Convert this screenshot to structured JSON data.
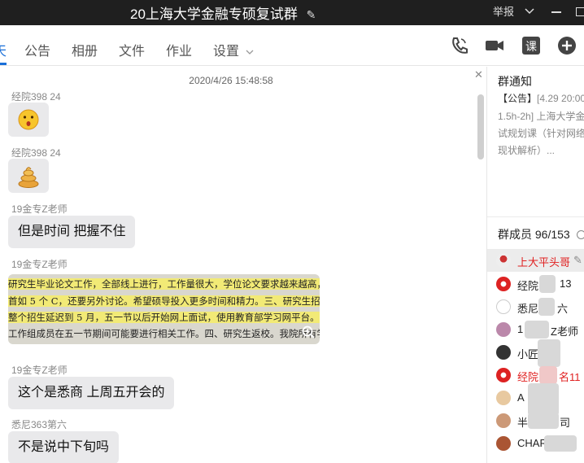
{
  "window": {
    "title": "20上海大学金融专硕复试群",
    "report": "举报"
  },
  "tabs": [
    "天",
    "公告",
    "相册",
    "文件",
    "作业",
    "设置"
  ],
  "chat": {
    "timestamp": "2020/4/26 15:48:58",
    "messages": [
      {
        "sender": "经院398  24",
        "type": "emoji",
        "emoji": "surprised-face"
      },
      {
        "sender": "经院398  24",
        "type": "emoji",
        "emoji": "poop"
      },
      {
        "sender": "19金专Z老师",
        "type": "text",
        "text": "但是时间 把握不住"
      },
      {
        "sender": "19金专Z老师",
        "type": "image"
      },
      {
        "sender": "19金专Z老师",
        "type": "text",
        "text": "这个是悉商 上周五开会的"
      },
      {
        "sender": "悉尼363第六",
        "type": "text",
        "text": "不是说中下旬吗"
      }
    ],
    "image_lines": [
      "研究生毕业论文工作，全部线上进行，工作量很大，学位论文要求越来越高，校",
      "首如 5 个 C，还要另外讨论。希望硕导投入更多时间和精力。三、研究生招生。",
      "整个招生延迟到 5 月，五一节以后开始网上面试，使用教育部学习网平台。面试",
      "工作组成员在五一节期间可能要进行相关工作。四、研究生返校。我院所有学"
    ]
  },
  "sidebar": {
    "notice_title": "群通知",
    "notice_lines": [
      {
        "prefix": "【公告】",
        "text": "[4.29 20:00"
      },
      {
        "prefix": "",
        "text": "1.5h-2h] 上海大学金"
      },
      {
        "prefix": "",
        "text": "试规划课（针对网络"
      },
      {
        "prefix": "",
        "text": "现状解析）..."
      }
    ],
    "members_title": "群成员 96/153",
    "members": [
      {
        "name": "上大平头哥",
        "red": true
      },
      {
        "name": "经院",
        "suffix": "13",
        "red": false
      },
      {
        "name": "悉尼",
        "suffix": "六",
        "red": false
      },
      {
        "name": "1",
        "suffix": "Z老师",
        "red": false
      },
      {
        "name": "小匠",
        "red": false
      },
      {
        "name": "经院",
        "suffix": "名11",
        "red": true
      },
      {
        "name": "A",
        "red": false
      },
      {
        "name": "半",
        "suffix": "司",
        "red": false
      },
      {
        "name": "CHAR",
        "red": false
      }
    ]
  },
  "colors": {
    "accent": "#1a6fd8",
    "titlebar": "#1f1f1f",
    "bubble": "#e9e9eb",
    "highlight": "#f2ea76"
  }
}
